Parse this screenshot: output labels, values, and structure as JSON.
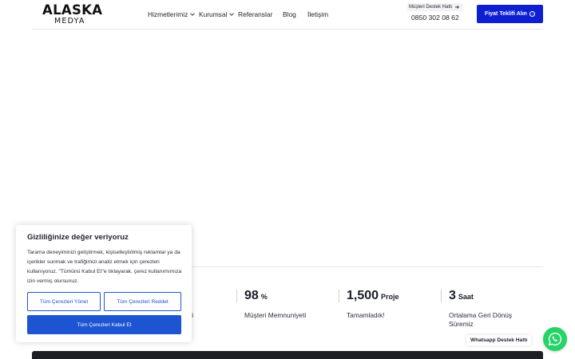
{
  "logo": {
    "main": "ALASKA",
    "sub": "MEDYA"
  },
  "nav": {
    "items": [
      {
        "label": "Hizmetlerimiz"
      },
      {
        "label": "Kurumsal"
      },
      {
        "label": "Referanslar"
      },
      {
        "label": "Blog"
      },
      {
        "label": "İletişim"
      }
    ]
  },
  "support": {
    "label": "Müşteri Destek Hattı",
    "phone": "0850 302 08 62"
  },
  "quote_button": {
    "label": "Fiyat Teklifi Alın"
  },
  "stats": [
    {
      "number": "",
      "unit": "",
      "label": "si"
    },
    {
      "number": "98",
      "unit": "%",
      "label": "Müşteri Memnuniyeti"
    },
    {
      "number": "1,500",
      "unit": "Proje",
      "label": "Tamamladık!"
    },
    {
      "number": "3",
      "unit": "Saat",
      "label": "Ortalama Geri Dönüş Süremiz"
    }
  ],
  "cookie": {
    "title": "Gizliliğinize değer veriyoruz",
    "text": "Tarama deneyiminizi geliştirmek, kişiselleştirilmiş reklamlar ya da içerikler sunmak ve trafiğimizi analiz etmek için çerezleri kullanıyoruz. \"Tümünü Kabul Et\"e tıklayarak, çerez kullanımımıza izin vermiş olursunuz.",
    "manage_label": "Tüm Çerezleri Yönet",
    "reject_label": "Tüm Çerezleri Reddet",
    "accept_label": "Tüm Çerezleri Kabul Et"
  },
  "whatsapp": {
    "label": "Whatsapp Destek Hattı"
  },
  "colors": {
    "primary": "#0d1fd1",
    "cookie_accent": "#1c54d2",
    "whatsapp": "#25d366"
  }
}
